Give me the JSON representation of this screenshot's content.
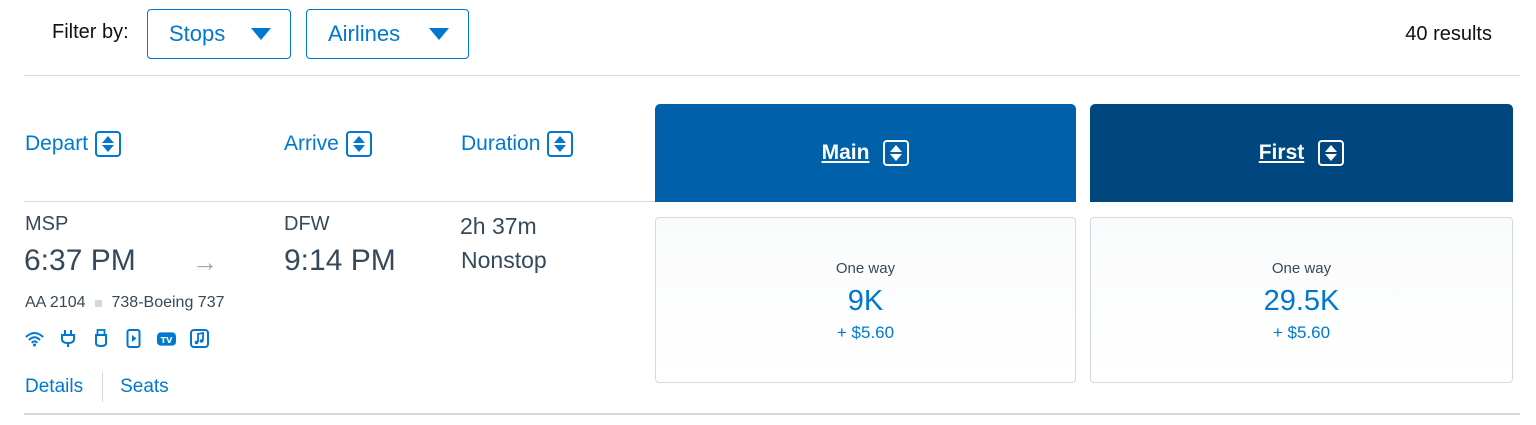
{
  "filters": {
    "label": "Filter by:",
    "stops_label": "Stops",
    "airlines_label": "Airlines",
    "results": "40 results"
  },
  "columns": {
    "depart": "Depart",
    "arrive": "Arrive",
    "duration": "Duration",
    "main": "Main",
    "first": "First"
  },
  "flight": {
    "origin": "MSP",
    "depart_time": "6:37 PM",
    "destination": "DFW",
    "arrive_time": "9:14 PM",
    "duration": "2h 37m",
    "stops": "Nonstop",
    "flight_number": "AA 2104",
    "aircraft": "738-Boeing 737",
    "amenities": [
      "wifi-icon",
      "power-outlet-icon",
      "usb-icon",
      "on-demand-video-icon",
      "live-tv-icon",
      "music-icon"
    ],
    "details_link": "Details",
    "seats_link": "Seats"
  },
  "fares": {
    "main": {
      "label": "One way",
      "miles": "9K",
      "taxes": "+ $5.60"
    },
    "first": {
      "label": "One way",
      "miles": "29.5K",
      "taxes": "+ $5.60"
    }
  },
  "colors": {
    "link_blue": "#0078d2",
    "main_header": "#0061ab",
    "first_header": "#00467f",
    "text": "#36495a",
    "border": "#d0dae0"
  }
}
